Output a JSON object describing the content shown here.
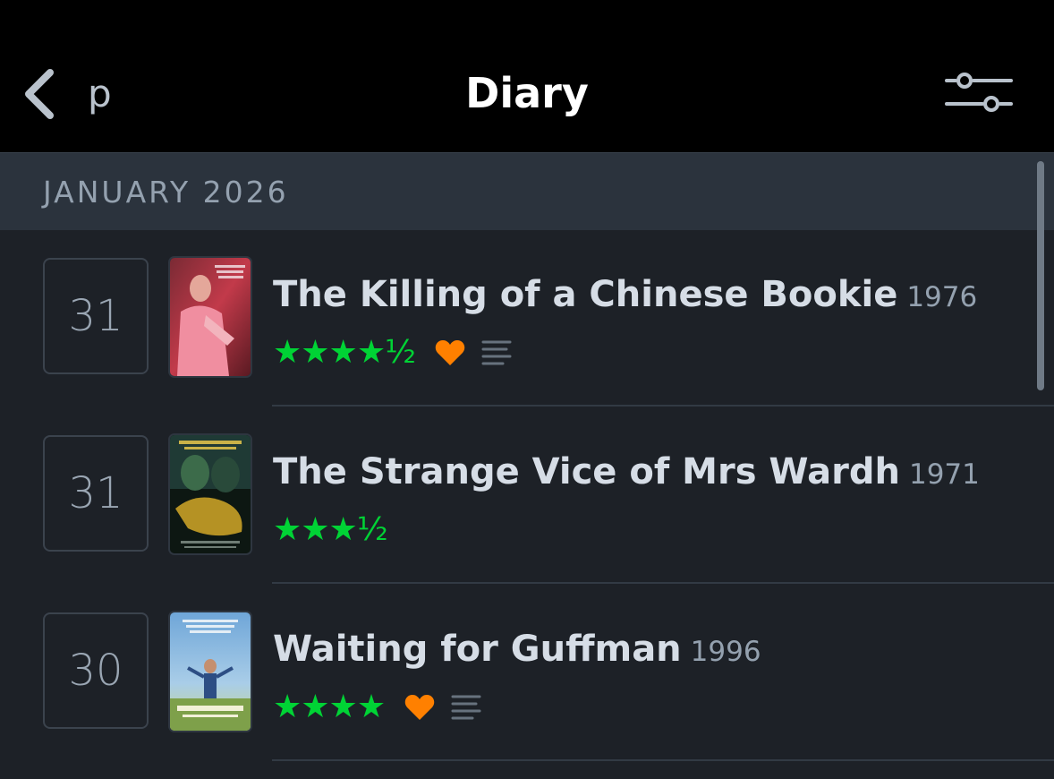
{
  "nav": {
    "back_label": "p",
    "title": "Diary",
    "back_icon": "chevron-left-icon",
    "filter_icon": "sliders-icon"
  },
  "section": {
    "label": "JANUARY 2026"
  },
  "colors": {
    "accent_green": "#00d335",
    "heart_orange": "#ff8000",
    "background": "#1d2127",
    "header_bg": "#2b333d"
  },
  "entries": [
    {
      "day": "31",
      "title": "The Killing of a Chinese Bookie",
      "year": "1976",
      "stars": "★★★★½",
      "rating": 4.5,
      "liked": true,
      "has_review": true
    },
    {
      "day": "31",
      "title": "The Strange Vice of Mrs Wardh",
      "year": "1971",
      "stars": "★★★½",
      "rating": 3.5,
      "liked": false,
      "has_review": false
    },
    {
      "day": "30",
      "title": "Waiting for Guffman",
      "year": "1996",
      "stars": "★★★★",
      "rating": 4,
      "liked": true,
      "has_review": true
    }
  ]
}
